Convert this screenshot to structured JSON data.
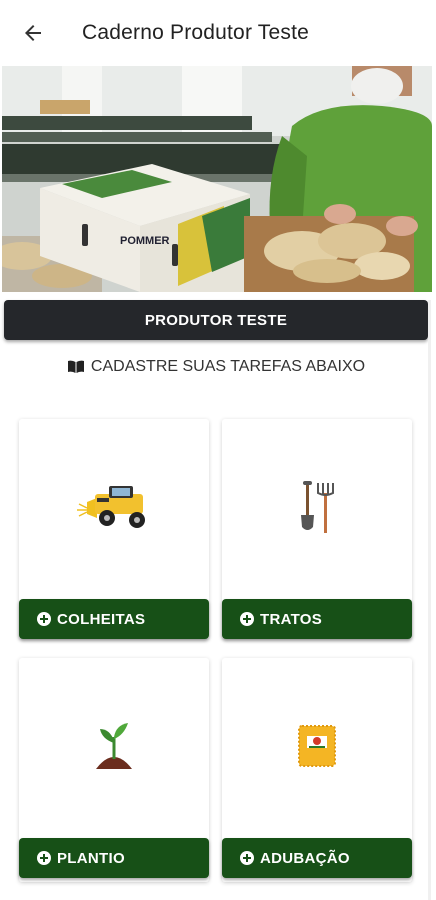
{
  "header": {
    "title": "Caderno Produtor Teste",
    "back_icon": "arrow-left-icon"
  },
  "hero": {
    "box_brand": "POMMER"
  },
  "producer": {
    "button_label": "PRODUTOR TESTE"
  },
  "section": {
    "subtitle": "CADASTRE SUAS TAREFAS ABAIXO",
    "icon": "book-open-icon"
  },
  "colors": {
    "primary_green": "#175017",
    "dark_button": "#25272b"
  },
  "tasks": [
    {
      "label": "COLHEITAS",
      "icon": "harvester-icon"
    },
    {
      "label": "TRATOS",
      "icon": "shovel-pitchfork-icon"
    },
    {
      "label": "PLANTIO",
      "icon": "seedling-icon"
    },
    {
      "label": "ADUBAÇÃO",
      "icon": "fertilizer-bag-icon"
    }
  ]
}
